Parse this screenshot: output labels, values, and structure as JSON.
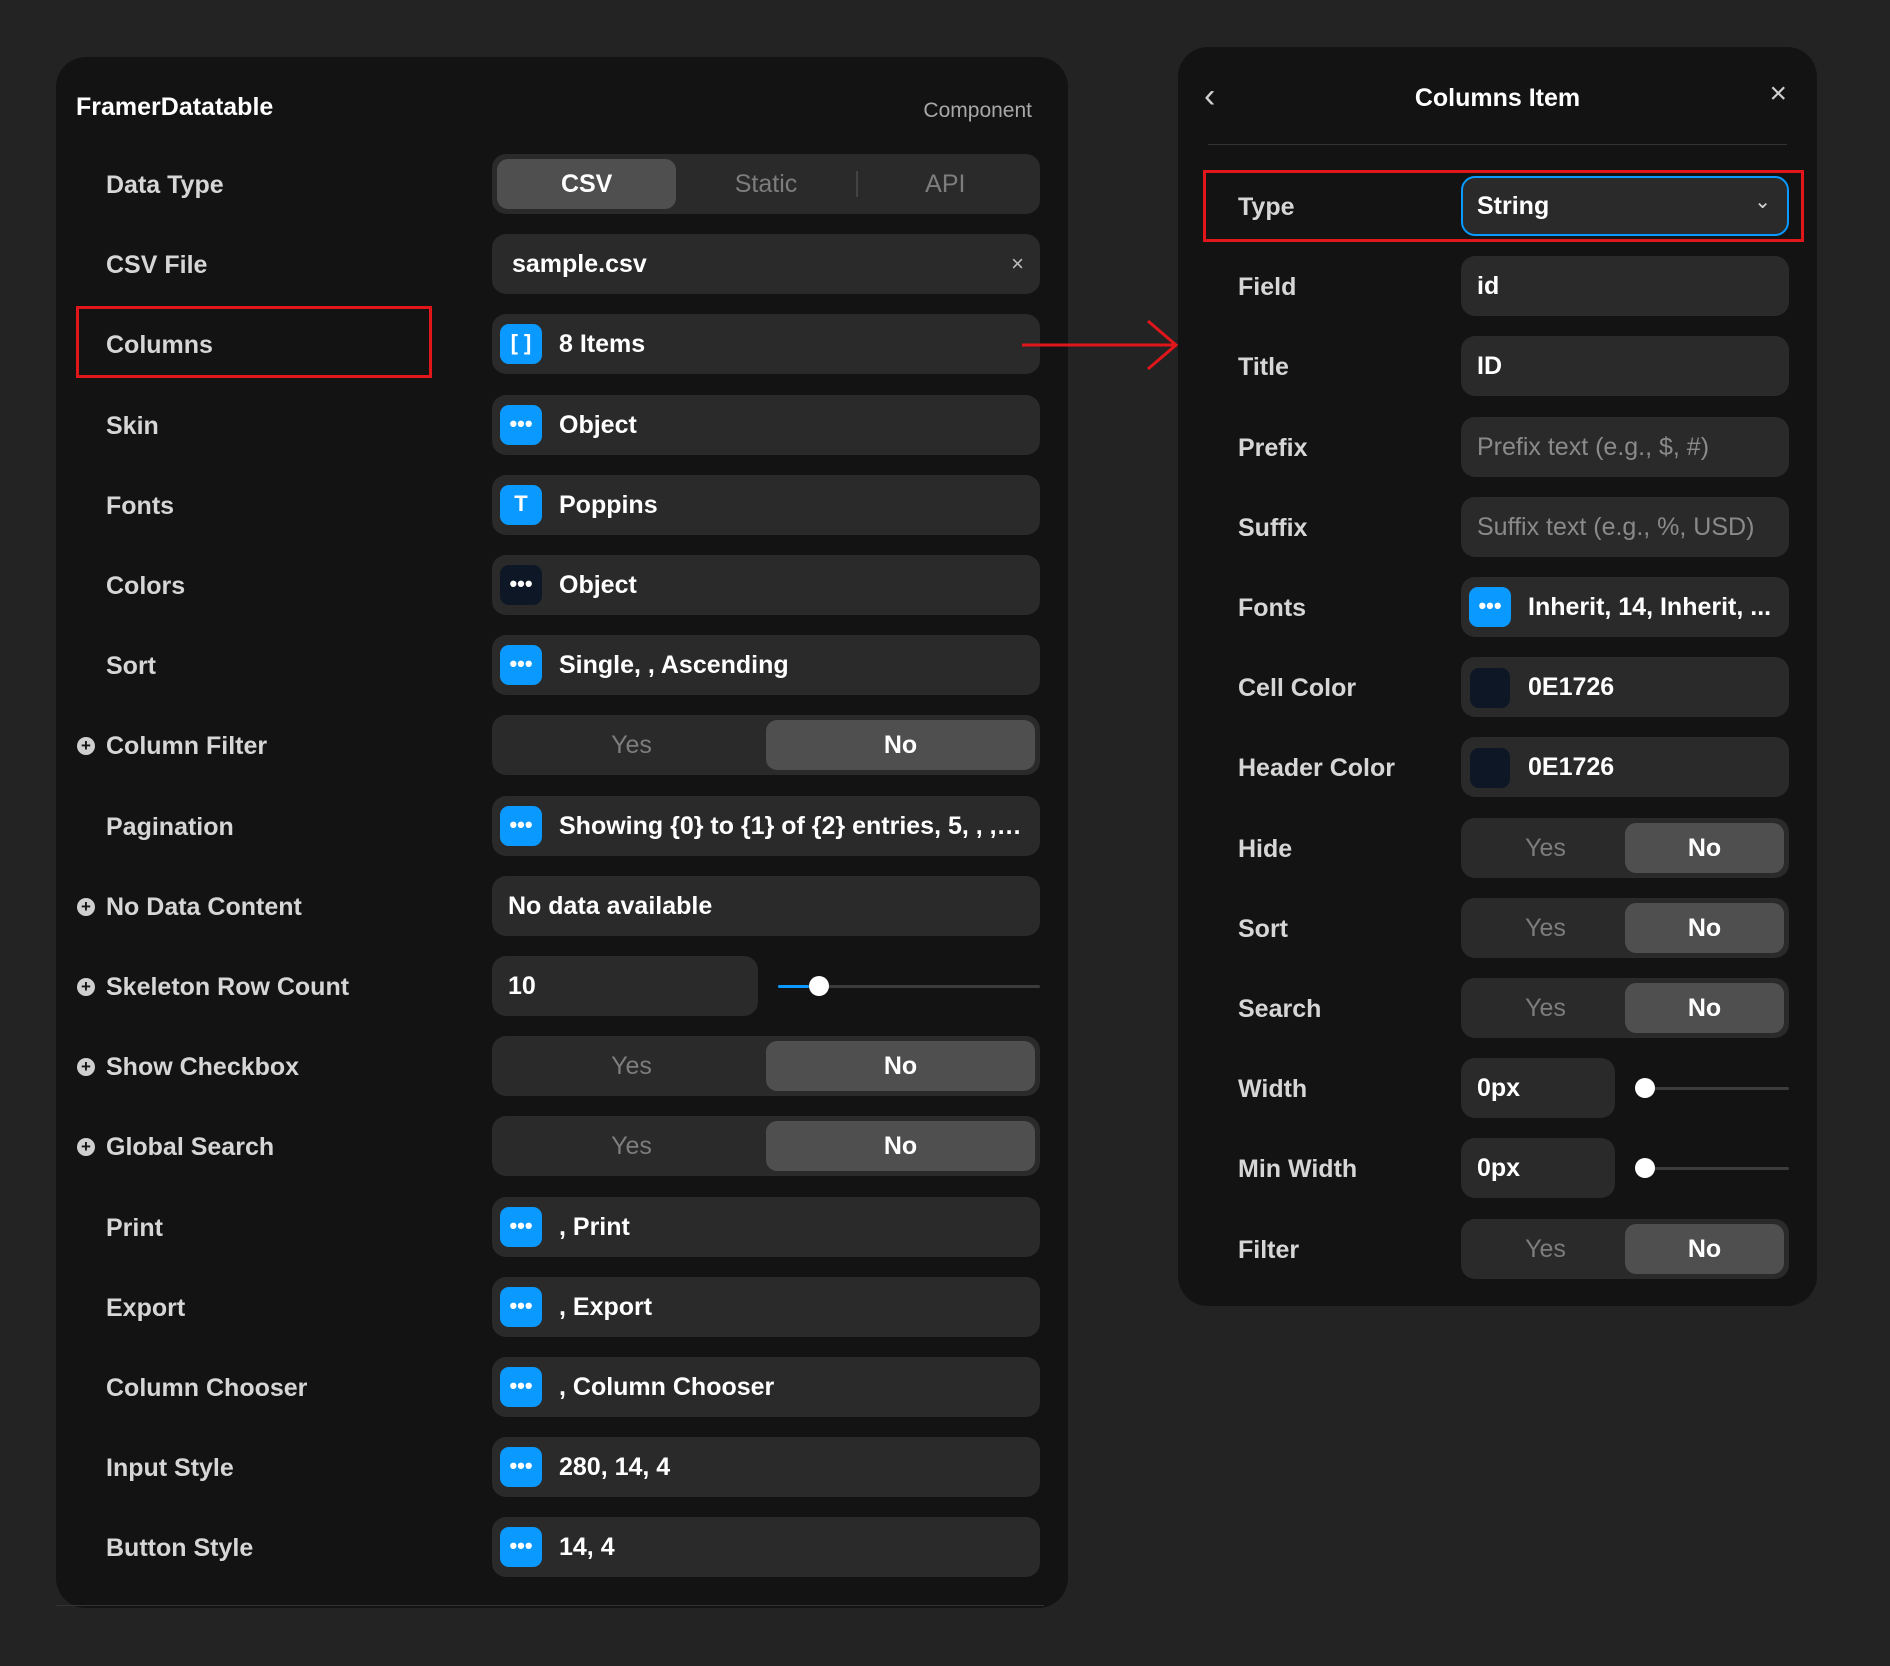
{
  "left": {
    "title": "FramerDatatable",
    "subtitle": "Component",
    "rows": [
      {
        "label": "Data Type",
        "type": "segment3",
        "options": [
          "CSV",
          "Static",
          "API"
        ],
        "selected": 0
      },
      {
        "label": "CSV File",
        "type": "file",
        "value": "sample.csv",
        "clear": "×"
      },
      {
        "label": "Columns",
        "type": "icon",
        "icon": "array-icon",
        "glyph": "[ ]",
        "value": "8 Items"
      },
      {
        "label": "Skin",
        "type": "icon",
        "icon": "more-icon",
        "glyph": "•••",
        "value": "Object"
      },
      {
        "label": "Fonts",
        "type": "icon",
        "icon": "text-icon",
        "glyph": "T",
        "value": "Poppins"
      },
      {
        "label": "Colors",
        "type": "icon",
        "icon": "more-icon",
        "glyph": "•••",
        "value": "Object",
        "dark": true
      },
      {
        "label": "Sort",
        "type": "icon",
        "icon": "more-icon",
        "glyph": "•••",
        "value": "Single, , Ascending"
      },
      {
        "label": "Column Filter",
        "type": "toggle",
        "options": [
          "Yes",
          "No"
        ],
        "selected": 1,
        "plus": true
      },
      {
        "label": "Pagination",
        "type": "icon",
        "icon": "more-icon",
        "glyph": "•••",
        "value": "Showing {0} to {1} of {2} entries, 5, , , ..."
      },
      {
        "label": "No Data Content",
        "type": "text",
        "value": "No data available",
        "plus": true
      },
      {
        "label": "Skeleton Row Count",
        "type": "slider",
        "value": "10",
        "plus": true,
        "level": 0.12
      },
      {
        "label": "Show Checkbox",
        "type": "toggle",
        "options": [
          "Yes",
          "No"
        ],
        "selected": 1,
        "plus": true
      },
      {
        "label": "Global Search",
        "type": "toggle",
        "options": [
          "Yes",
          "No"
        ],
        "selected": 1,
        "plus": true
      },
      {
        "label": "Print",
        "type": "icon",
        "icon": "more-icon",
        "glyph": "•••",
        "value": ", Print"
      },
      {
        "label": "Export",
        "type": "icon",
        "icon": "more-icon",
        "glyph": "•••",
        "value": ", Export"
      },
      {
        "label": "Column Chooser",
        "type": "icon",
        "icon": "more-icon",
        "glyph": "•••",
        "value": ", Column Chooser"
      },
      {
        "label": "Input Style",
        "type": "icon",
        "icon": "more-icon",
        "glyph": "•••",
        "value": "280, 14, 4"
      },
      {
        "label": "Button Style",
        "type": "icon",
        "icon": "more-icon",
        "glyph": "•••",
        "value": "14, 4"
      }
    ]
  },
  "right": {
    "title": "Columns Item",
    "back": "‹",
    "close": "×",
    "rows": [
      {
        "label": "Type",
        "type": "select",
        "value": "String",
        "chevron": "⌄"
      },
      {
        "label": "Field",
        "type": "text",
        "value": "id"
      },
      {
        "label": "Title",
        "type": "text",
        "value": "ID"
      },
      {
        "label": "Prefix",
        "type": "placeholder",
        "placeholder": "Prefix text (e.g., $, #)"
      },
      {
        "label": "Suffix",
        "type": "placeholder",
        "placeholder": "Suffix text (e.g., %, USD)"
      },
      {
        "label": "Fonts",
        "type": "icon",
        "icon": "more-icon",
        "glyph": "•••",
        "value": "Inherit, 14, Inherit, ..."
      },
      {
        "label": "Cell Color",
        "type": "color",
        "value": "0E1726",
        "color": "#0E1726"
      },
      {
        "label": "Header Color",
        "type": "color",
        "value": "0E1726",
        "color": "#0E1726"
      },
      {
        "label": "Hide",
        "type": "toggle",
        "options": [
          "Yes",
          "No"
        ],
        "selected": 1
      },
      {
        "label": "Sort",
        "type": "toggle",
        "options": [
          "Yes",
          "No"
        ],
        "selected": 1
      },
      {
        "label": "Search",
        "type": "toggle",
        "options": [
          "Yes",
          "No"
        ],
        "selected": 1
      },
      {
        "label": "Width",
        "type": "slider",
        "value": "0px",
        "level": 0
      },
      {
        "label": "Min Width",
        "type": "slider",
        "value": "0px",
        "level": 0
      },
      {
        "label": "Filter",
        "type": "toggle",
        "options": [
          "Yes",
          "No"
        ],
        "selected": 1
      }
    ]
  },
  "colors": {
    "accent": "#0A99FF",
    "highlight": "#E0161B",
    "panel": "#131313",
    "control": "#2A2A2A"
  }
}
